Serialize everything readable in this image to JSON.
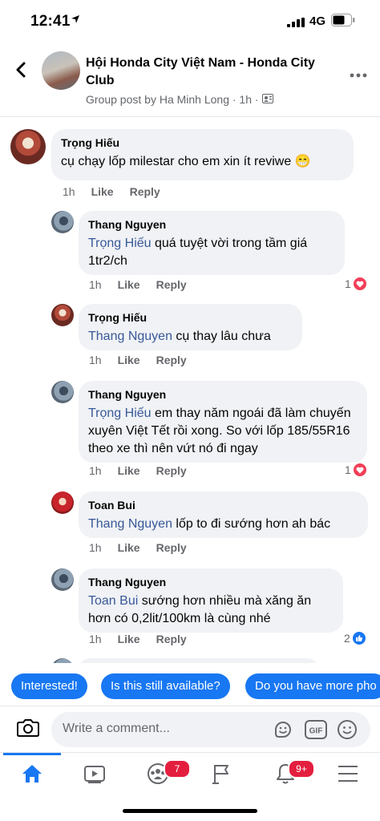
{
  "status_bar": {
    "time": "12:41",
    "network": "4G"
  },
  "header": {
    "group_name": "Hội Honda City Việt Nam - Honda City Club",
    "subtitle": "Group post by Ha Minh Long · 1h ·"
  },
  "comments": [
    {
      "author": "Trọng Hiếu",
      "mention": "",
      "text": "cụ chạy lốp milestar cho em xin ít reviwe 😁",
      "time": "1h",
      "like": "Like",
      "reply": "Reply",
      "reaction_count": ""
    },
    {
      "author": "Thang Nguyen",
      "mention": "Trọng Hiếu",
      "text": " quá tuyệt vời trong tầm giá 1tr2/ch",
      "time": "1h",
      "like": "Like",
      "reply": "Reply",
      "reaction_count": "1"
    },
    {
      "author": "Trọng Hiếu",
      "mention": "Thang Nguyen",
      "text": " cụ thay lâu chưa",
      "time": "1h",
      "like": "Like",
      "reply": "Reply",
      "reaction_count": ""
    },
    {
      "author": "Thang Nguyen",
      "mention": "Trọng Hiếu",
      "text": " em thay năm ngoái đã làm chuyến xuyên Việt Tết rồi xong. So với lốp 185/55R16 theo xe thì nên vứt nó đi ngay",
      "time": "1h",
      "like": "Like",
      "reply": "Reply",
      "reaction_count": "1"
    },
    {
      "author": "Toan Bui",
      "mention": "Thang Nguyen",
      "text": " lốp to đi sướng hơn ah bác",
      "time": "1h",
      "like": "Like",
      "reply": "Reply",
      "reaction_count": ""
    },
    {
      "author": "Thang Nguyen",
      "mention": "Toan Bui",
      "text": " sướng hơn nhiều mà xăng ăn hơn có 0,2lit/100km là cùng nhé",
      "time": "1h",
      "like": "Like",
      "reply": "Reply",
      "reaction_count": "2"
    }
  ],
  "quick_replies": [
    "Interested!",
    "Is this still available?",
    "Do you have more pho"
  ],
  "composer": {
    "placeholder": "Write a comment..."
  },
  "tab_bar": {
    "items": [
      {
        "icon": "home-icon",
        "badge": ""
      },
      {
        "icon": "watch-icon",
        "badge": ""
      },
      {
        "icon": "groups-icon",
        "badge": "7"
      },
      {
        "icon": "pages-flag-icon",
        "badge": ""
      },
      {
        "icon": "bell-icon",
        "badge": "9+"
      },
      {
        "icon": "menu-icon",
        "badge": ""
      }
    ]
  },
  "colors": {
    "accent": "#1877f2",
    "bubble": "#f0f2f5",
    "mention": "#385898",
    "heart": "#f33e58",
    "badge": "#e41e3f"
  }
}
